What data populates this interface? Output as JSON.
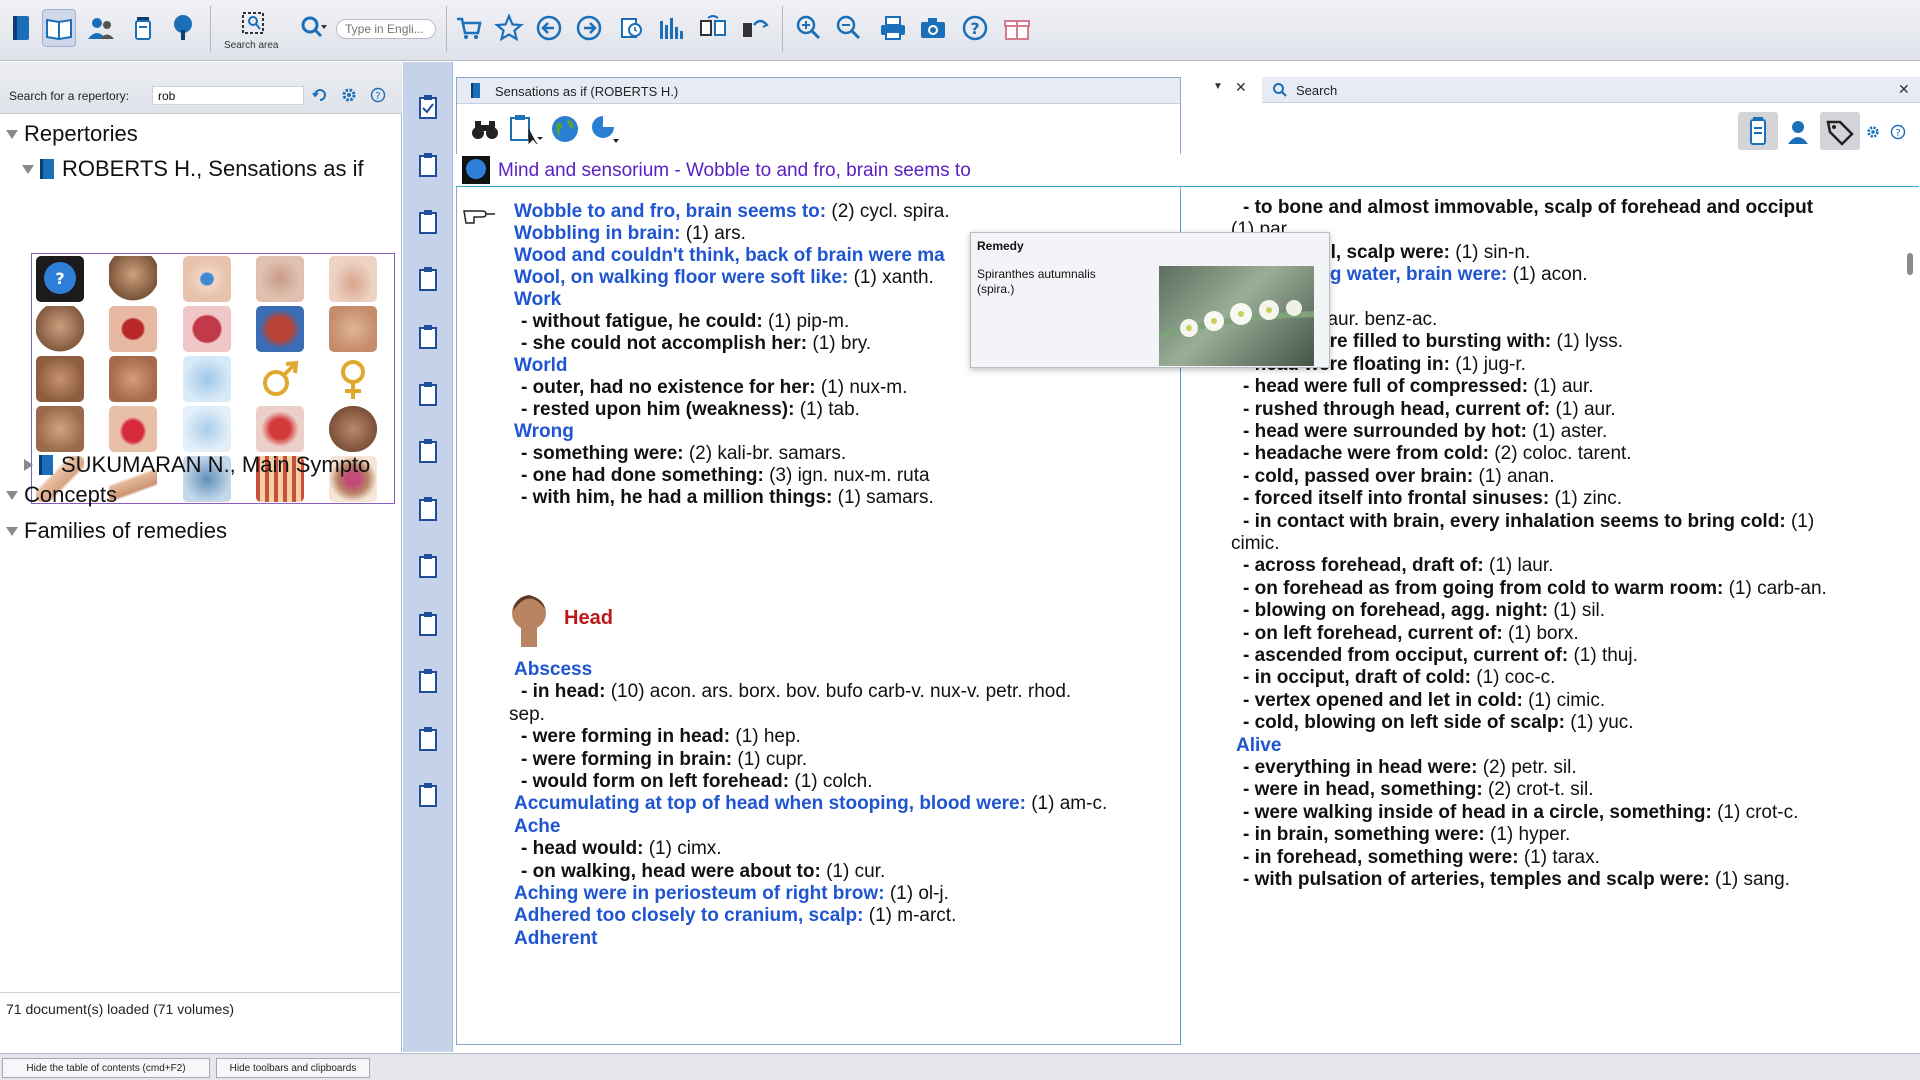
{
  "toolbar": {
    "search_area_label": "Search area",
    "search_placeholder": "Type in Engli..."
  },
  "left_panel": {
    "search_label": "Search for a repertory:",
    "search_value": "rob",
    "tree": [
      {
        "label": "Repertories"
      },
      {
        "label": "ROBERTS H., Sensations as if"
      },
      {
        "label": "SUKUMARAN N., Main Sympto"
      },
      {
        "label": "Concepts"
      },
      {
        "label": "Families of remedies"
      }
    ],
    "status": "71 document(s) loaded (71 volumes)"
  },
  "doc_panel": {
    "tab_title": "Sensations as if (ROBERTS H.)",
    "header": "Mind and sensorium - Wobble to and fro, brain seems to",
    "chapter": "Head",
    "col1": [
      {
        "r": "Wobble to and fro, brain seems to:",
        "t": "(2) cycl. spira."
      },
      {
        "r": "Wobbling in brain:",
        "t": "(1) ars."
      },
      {
        "r": "Wood and couldn't think, back of brain were ma",
        "t": ""
      },
      {
        "r": "Wool, on walking floor were soft like:",
        "t": "(1) xanth."
      },
      {
        "r": "Work",
        "t": ""
      },
      {
        "s": "- without fatigue, he could:",
        "t": "(1) pip-m."
      },
      {
        "s": "- she could not accomplish her:",
        "t": "(1) bry."
      },
      {
        "r": "World",
        "t": ""
      },
      {
        "s": "- outer, had no existence for her:",
        "t": "(1) nux-m."
      },
      {
        "s": "- rested upon him (weakness):",
        "t": "(1) tab."
      },
      {
        "r": "Wrong",
        "t": ""
      },
      {
        "s": "- something were:",
        "t": "(2) kali-br. samars."
      },
      {
        "s": "- one had done something:",
        "t": "(3) ign. nux-m. ruta"
      },
      {
        "s": "- with him, he had a million things:",
        "t": "(1) samars."
      }
    ],
    "col1b": [
      {
        "r": "Abscess",
        "t": ""
      },
      {
        "s": "- in head:",
        "t": "(10) acon. ars. borx. bov. bufo carb-v. nux-v. petr. rhod."
      },
      {
        "c": "sep."
      },
      {
        "s": "- were forming in head:",
        "t": "(1) hep."
      },
      {
        "s": "- were forming in brain:",
        "t": "(1) cupr."
      },
      {
        "s": "- would form on left forehead:",
        "t": "(1) colch."
      },
      {
        "r": "Accumulating at top of head when stooping, blood were:",
        "t": "(1) am-c."
      },
      {
        "r": "Ache",
        "t": ""
      },
      {
        "s": "- head would:",
        "t": "(1) cimx."
      },
      {
        "s": "- on walking, head were about to:",
        "t": "(1) cur."
      },
      {
        "r": "Aching were in periosteum of right brow:",
        "t": "(1) ol-j."
      },
      {
        "r": "Adhered too closely to cranium, scalp:",
        "t": "(1) m-arct."
      },
      {
        "r": "Adherent",
        "t": ""
      }
    ],
    "col2": [
      {
        "s": "- to bone and almost immovable, scalp of forehead and occiput",
        "t": ""
      },
      {
        "c": "(1) par."
      },
      {
        "s": "es of skull, scalp were:",
        "t": "(1) sin-n."
      },
      {
        "r": "with boiling water, brain were:",
        "t": "(1) acon."
      },
      {
        "c": ""
      },
      {
        "s": "head:",
        "t": "(2) aur. benz-ac."
      },
      {
        "s": "- head were filled to bursting with:",
        "t": "(1) lyss."
      },
      {
        "s": "- head were floating in:",
        "t": "(1) jug-r."
      },
      {
        "s": "- head were full of compressed:",
        "t": "(1) aur."
      },
      {
        "s": "- rushed through head, current of:",
        "t": "(1) aur."
      },
      {
        "s": "- head were surrounded by hot:",
        "t": "(1) aster."
      },
      {
        "s": "- headache were from cold:",
        "t": "(2) coloc. tarent."
      },
      {
        "s": "- cold, passed over brain:",
        "t": "(1) anan."
      },
      {
        "s": "- forced itself into frontal sinuses:",
        "t": "(1) zinc."
      },
      {
        "s": "- in contact with brain, every inhalation seems to bring cold:",
        "t": "(1)"
      },
      {
        "c": "cimic."
      },
      {
        "s": "- across forehead, draft of:",
        "t": "(1) laur."
      },
      {
        "s": "- on forehead as from going from cold to warm room:",
        "t": "(1) carb-an."
      },
      {
        "s": "- blowing on forehead, agg. night:",
        "t": "(1) sil."
      },
      {
        "s": "- on left forehead, current of:",
        "t": "(1) borx."
      },
      {
        "s": "- ascended from occiput, current of:",
        "t": "(1) thuj."
      },
      {
        "s": "- in occiput, draft of cold:",
        "t": "(1) coc-c."
      },
      {
        "s": "- vertex opened and let in cold:",
        "t": "(1) cimic."
      },
      {
        "s": "- cold, blowing on left side of scalp:",
        "t": "(1) yuc."
      },
      {
        "r": "Alive",
        "t": ""
      },
      {
        "s": "- everything in head were:",
        "t": "(2) petr. sil."
      },
      {
        "s": "- were in head, something:",
        "t": "(2) crot-t. sil."
      },
      {
        "s": "- were walking inside of head in a circle, something:",
        "t": "(1) crot-c."
      },
      {
        "s": "- in brain, something were:",
        "t": "(1) hyper."
      },
      {
        "s": "- in forehead, something were:",
        "t": "(1) tarax."
      },
      {
        "s": "- with pulsation of arteries, temples and scalp were:",
        "t": "(1) sang."
      }
    ]
  },
  "search_panel": {
    "tab_title": "Search"
  },
  "tooltip": {
    "title": "Remedy",
    "text": "Spiranthes autumnalis (spira.)"
  },
  "bottom": {
    "hide_toc": "Hide the table of contents (cmd+F2)",
    "hide_toolbars": "Hide toolbars and clipboards"
  }
}
